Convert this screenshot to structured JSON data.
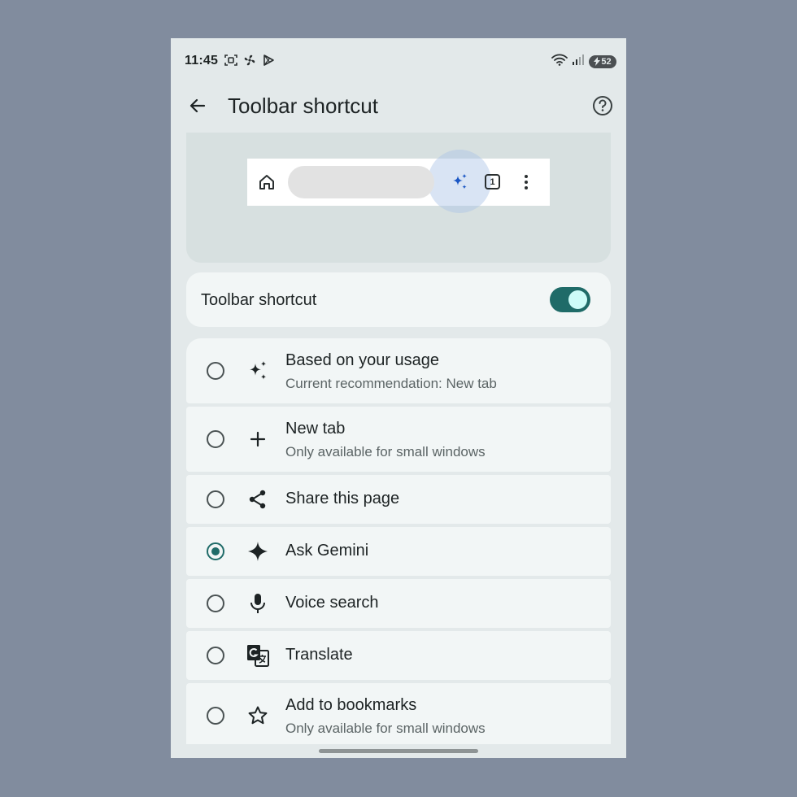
{
  "status_bar": {
    "time": "11:45",
    "battery": "52"
  },
  "app_bar": {
    "title": "Toolbar shortcut"
  },
  "preview": {
    "tab_count": "1"
  },
  "toggle": {
    "label": "Toolbar shortcut",
    "on": true
  },
  "options": [
    {
      "title": "Based on your usage",
      "subtitle": "Current recommendation:  New tab",
      "icon": "auto-awesome-icon",
      "selected": false
    },
    {
      "title": "New tab",
      "subtitle": "Only available for small windows",
      "icon": "plus-icon",
      "selected": false
    },
    {
      "title": "Share this page",
      "subtitle": "",
      "icon": "share-icon",
      "selected": false
    },
    {
      "title": "Ask Gemini",
      "subtitle": "",
      "icon": "gemini-sparkle-icon",
      "selected": true
    },
    {
      "title": "Voice search",
      "subtitle": "",
      "icon": "microphone-icon",
      "selected": false
    },
    {
      "title": "Translate",
      "subtitle": "",
      "icon": "translate-icon",
      "selected": false
    },
    {
      "title": "Add to bookmarks",
      "subtitle": "Only available for small windows",
      "icon": "star-outline-icon",
      "selected": false
    }
  ],
  "colors": {
    "accent": "#1f6b68",
    "background": "#e3e9ea",
    "card": "#f2f6f6",
    "preview_sparkle": "#1a56c4"
  }
}
